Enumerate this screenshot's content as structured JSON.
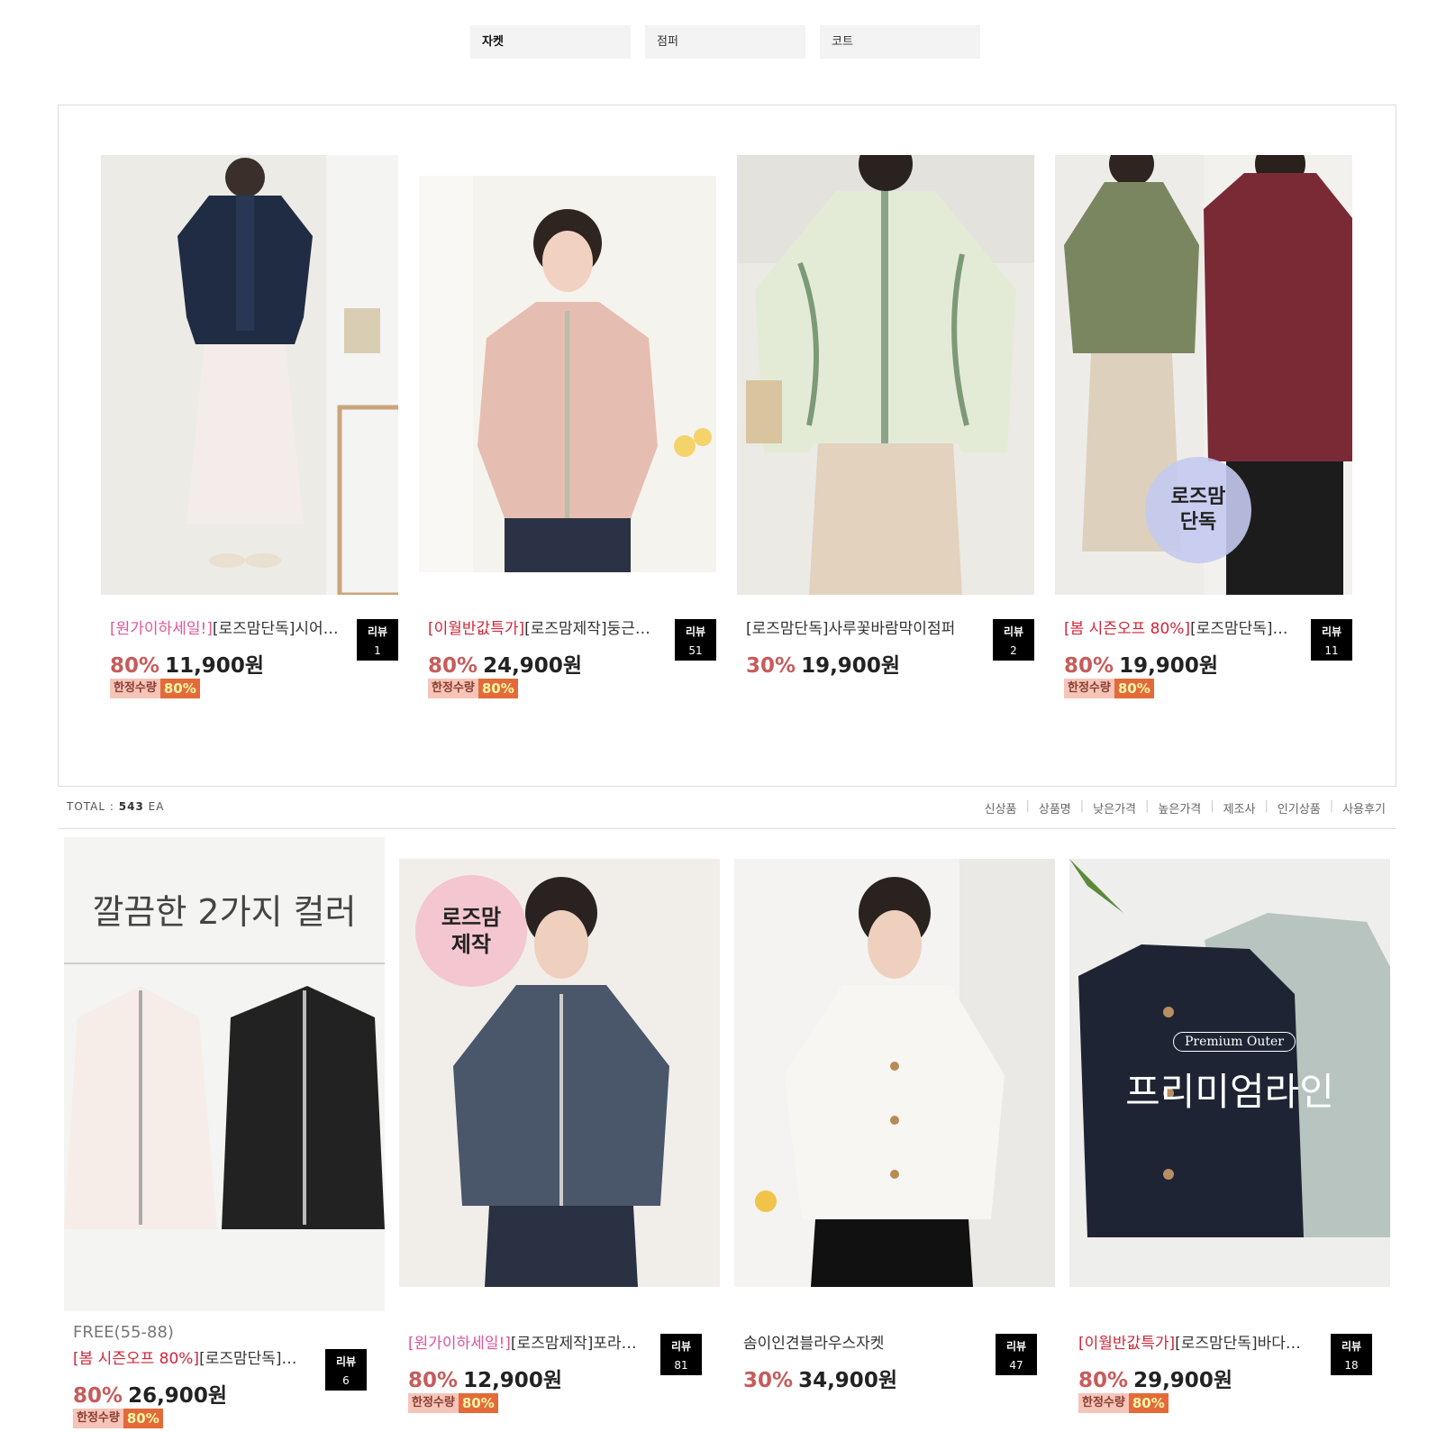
{
  "categories": [
    {
      "label": "자켓"
    },
    {
      "label": "점퍼"
    },
    {
      "label": "코트"
    }
  ],
  "featured": [
    {
      "tag": "[원가이하세일!]",
      "tag_color": "pink",
      "name": "[로즈맘단독]시어서커셔링자켓",
      "discount": "80%",
      "price": "11,900원",
      "limited": true,
      "review_label": "리뷰",
      "review_count": "1"
    },
    {
      "tag": "[이월반값특가]",
      "tag_color": "red",
      "name": "[로즈맘제작]둥근카라바람막이자켓",
      "discount": "80%",
      "price": "24,900원",
      "limited": true,
      "review_label": "리뷰",
      "review_count": "51"
    },
    {
      "tag": "",
      "tag_color": "",
      "name": "[로즈맘단독]사루꽃바람막이점퍼",
      "discount": "30%",
      "price": "19,900원",
      "limited": false,
      "review_label": "리뷰",
      "review_count": "2"
    },
    {
      "tag": "[봄 시즌오프 80%]",
      "tag_color": "red",
      "name": "[로즈맘단독]후드바람막이점퍼",
      "discount": "80%",
      "price": "19,900원",
      "limited": true,
      "review_label": "리뷰",
      "review_count": "11"
    }
  ],
  "limited_label": "한정수량",
  "limited_pct": "80%",
  "total": {
    "label": "TOTAL :",
    "count": "543",
    "unit": "EA"
  },
  "sorts": [
    "신상품",
    "상품명",
    "낮은가격",
    "높은가격",
    "제조사",
    "인기상품",
    "사용후기"
  ],
  "products": [
    {
      "free": "FREE(55-88)",
      "tag": "[봄 시즌오프 80%]",
      "tag_color": "red",
      "name": "[로즈맘단독]바스락자켓",
      "discount": "80%",
      "price": "26,900원",
      "limited": true,
      "review_label": "리뷰",
      "review_count": "6",
      "banner": "깔끔한 2가지 컬러"
    },
    {
      "free": "",
      "tag": "[원가이하세일!]",
      "tag_color": "pink",
      "name": "[로즈맘제작]포라이트후드자켓",
      "discount": "80%",
      "price": "12,900원",
      "limited": true,
      "review_label": "리뷰",
      "review_count": "81",
      "badge": "로즈맘 제작"
    },
    {
      "free": "",
      "tag": "",
      "tag_color": "",
      "name": "솜이인견블라우스자켓",
      "discount": "30%",
      "price": "34,900원",
      "limited": false,
      "review_label": "리뷰",
      "review_count": "47"
    },
    {
      "free": "",
      "tag": "[이월반값특가]",
      "tag_color": "red",
      "name": "[로즈맘단독]바다솔자켓",
      "discount": "80%",
      "price": "29,900원",
      "limited": true,
      "review_label": "리뷰",
      "review_count": "18",
      "banner": "프리미엄라인",
      "banner_sub": "Premium Outer"
    }
  ],
  "badge_featured_4": "로즈맘 단독",
  "colors": {
    "discount": "#c75b5b",
    "tag_pink": "#e0559a",
    "tag_red": "#d0263a",
    "limited_bg": "#f6c5ba",
    "limited_pct_bg": "#e46a3a"
  }
}
